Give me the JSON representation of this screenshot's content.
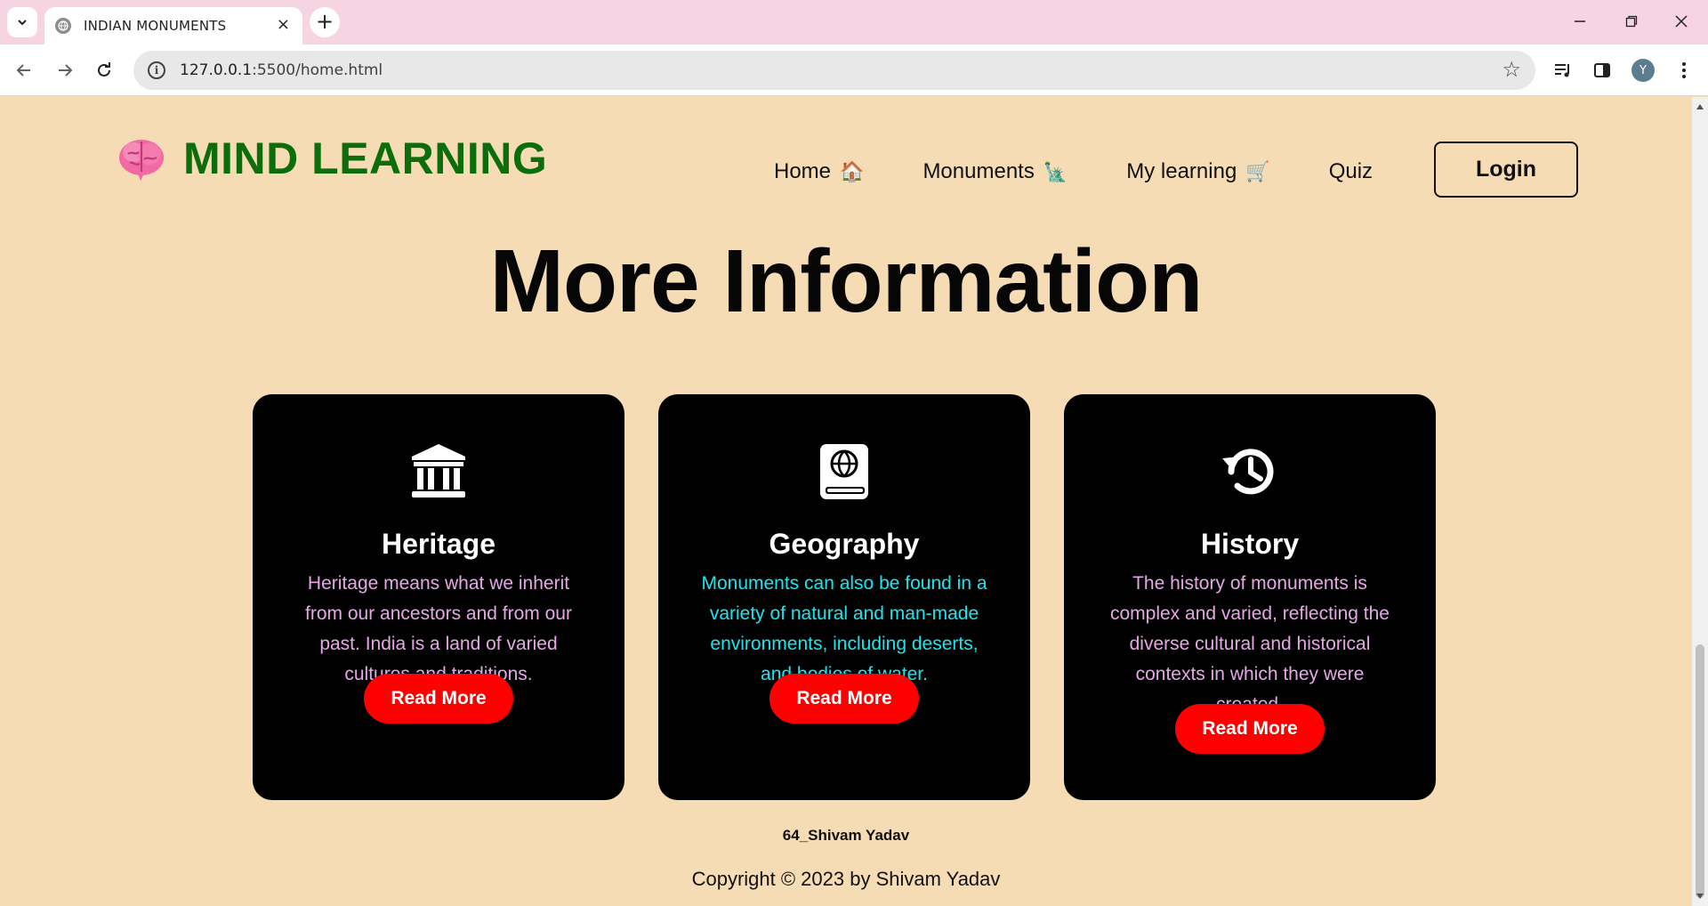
{
  "browser": {
    "tab_title": "INDIAN MONUMENTS",
    "tab_close": "×",
    "new_tab": "+",
    "url_host": "127.0.0.1",
    "url_path": ":5500/home.html",
    "profile_initial": "Y"
  },
  "site": {
    "brand": "MIND LEARNING",
    "nav": [
      {
        "label": "Home",
        "emoji": "🏠"
      },
      {
        "label": "Monuments",
        "emoji": "🗽"
      },
      {
        "label": "My learning",
        "emoji": "🛒"
      },
      {
        "label": "Quiz",
        "emoji": ""
      }
    ],
    "login_label": "Login",
    "heading": "More Information",
    "cards": [
      {
        "title": "Heritage",
        "icon": "landmark-icon",
        "text": "Heritage means what we inherit from our ancestors and from our past. India is a land of varied cultures and traditions.",
        "text_color": "#e8a6e8",
        "button": "Read More"
      },
      {
        "title": "Geography",
        "icon": "atlas-icon",
        "text": "Monuments can also be found in a variety of natural and man-made environments, including deserts, and bodies of water.",
        "text_color": "#19e6f0",
        "button": "Read More"
      },
      {
        "title": "History",
        "icon": "history-icon",
        "text": "The history of monuments is complex and varied, reflecting the diverse cultural and historical contexts in which they were created.",
        "text_color": "#e8a6e8",
        "button": "Read More"
      }
    ],
    "author": "64_Shivam Yadav",
    "copyright": "Copyright © 2023 by Shivam Yadav"
  },
  "colors": {
    "page_bg": "#f5dcb4",
    "brand_green": "#0b6e0b",
    "button_red": "#ff0000",
    "tabbar_pink": "#f6d4e2"
  }
}
